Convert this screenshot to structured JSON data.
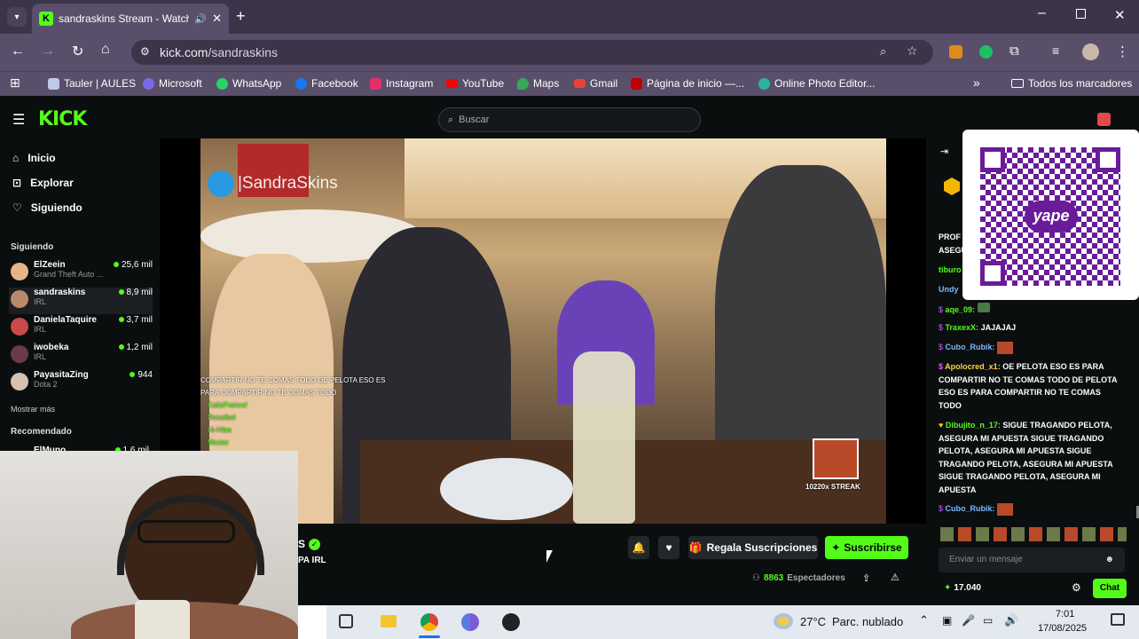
{
  "browser": {
    "tab_title": "sandraskins Stream - Watch",
    "url_host": "kick.com",
    "url_path": "/sandraskins",
    "bookmarks": [
      "Tauler | AULES",
      "Microsoft",
      "WhatsApp",
      "Facebook",
      "Instagram",
      "YouTube",
      "Maps",
      "Gmail",
      "Página de inicio —...",
      "Online Photo Editor..."
    ],
    "all_bookmarks": "Todos los marcadores",
    "overflow": "»"
  },
  "kick": {
    "logo": "KICK",
    "search_placeholder": "Buscar",
    "nav": [
      "Inicio",
      "Explorar",
      "Siguiendo"
    ],
    "following_heading": "Siguiendo",
    "following": [
      {
        "name": "ElZeein",
        "category": "Grand Theft Auto ...",
        "viewers": "25,6 mil"
      },
      {
        "name": "sandraskins",
        "category": "IRL",
        "viewers": "8,9 mil"
      },
      {
        "name": "DanielaTaquire",
        "category": "IRL",
        "viewers": "3,7 mil"
      },
      {
        "name": "iwobeka",
        "category": "IRL",
        "viewers": "1,2 mil"
      },
      {
        "name": "PayasitaZing",
        "category": "Dota 2",
        "viewers": "944"
      }
    ],
    "show_more": "Mostrar más",
    "recommended_heading": "Recomendado",
    "recommended_partial": {
      "name": "ElMuno",
      "viewers": "1,6 mil"
    }
  },
  "video": {
    "twitter_handle": "|SandraSkins",
    "overlay_lines": [
      "COMPARTIR NO TE COMAS TODO DE PELOTA ESO ES",
      "PARA COMPARTIR NO TE COMAS TODO"
    ],
    "overlay_users": [
      "CalizFranco!",
      "RosaIbel",
      "Hi-Hiba",
      "Mozaz"
    ],
    "streak_label": "10220x STREAK"
  },
  "channel": {
    "name_partial": "S",
    "category_partial": "PA IRL",
    "gift_label": "Regala Suscripciones",
    "subscribe_label": "Suscribirse",
    "viewers": "8863",
    "viewers_label": "Espectadores"
  },
  "chat": {
    "pinned_partial": [
      "PROF",
      "ASEGU"
    ],
    "partial_users": [
      "tiburo",
      "Undy"
    ],
    "messages": [
      {
        "user": "aqe_09:",
        "text": "",
        "color": "#53fc18"
      },
      {
        "user": "TraxexX:",
        "text": "JAJAJAJ",
        "color": "#53fc18"
      },
      {
        "user": "Cubo_Rubik:",
        "text": "",
        "color": "#7ab8ff"
      },
      {
        "user": "Apolocred_x1:",
        "text": "OE PELOTA ESO ES PARA COMPARTIR NO TE COMAS TODO DE PELOTA ESO ES PARA COMPARTIR NO TE COMAS TODO",
        "color": "#ffd24a"
      },
      {
        "user": "Dibujito_n_17:",
        "text": "SIGUE TRAGANDO PELOTA, ASEGURA MI APUESTA SIGUE TRAGANDO PELOTA, ASEGURA MI APUESTA SIGUE TRAGANDO PELOTA, ASEGURA MI APUESTA SIGUE TRAGANDO PELOTA, ASEGURA MI APUESTA",
        "color": "#53fc18"
      },
      {
        "user": "Cubo_Rubik:",
        "text": "",
        "color": "#7ab8ff"
      }
    ],
    "input_placeholder": "Enviar un mensaje",
    "points": "17.040",
    "chat_button": "Chat",
    "qr_brand": "yape"
  },
  "taskbar": {
    "temperature": "27°C",
    "weather": "Parc. nublado",
    "time": "7:01",
    "date": "17/08/2025"
  },
  "colors": {
    "kick_green": "#53fc18",
    "browser_frame": "#3c3449",
    "toolbar": "#5a4f6b",
    "yape_purple": "#6a1b9a"
  }
}
